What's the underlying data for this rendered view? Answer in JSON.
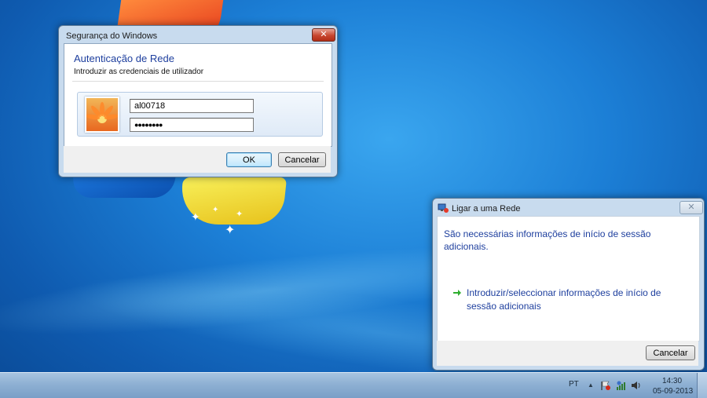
{
  "security_dialog": {
    "title": "Segurança do Windows",
    "heading": "Autenticação de Rede",
    "subheading": "Introduzir as credenciais de utilizador",
    "username_value": "al00718",
    "password_value": "●●●●●●●●",
    "ok_label": "OK",
    "cancel_label": "Cancelar",
    "close_icon": "close-icon"
  },
  "network_dialog": {
    "title": "Ligar a uma Rede",
    "message": "São necessárias informações de início de sessão adicionais.",
    "link_label": "Introduzir/seleccionar informações de início de sessão adicionais",
    "cancel_label": "Cancelar",
    "close_icon": "close-icon"
  },
  "taskbar": {
    "language": "PT",
    "time": "14:30",
    "date": "05-09-2013"
  },
  "colors": {
    "heading_blue": "#1e3f9e",
    "link_arrow_green": "#2fae2f"
  }
}
